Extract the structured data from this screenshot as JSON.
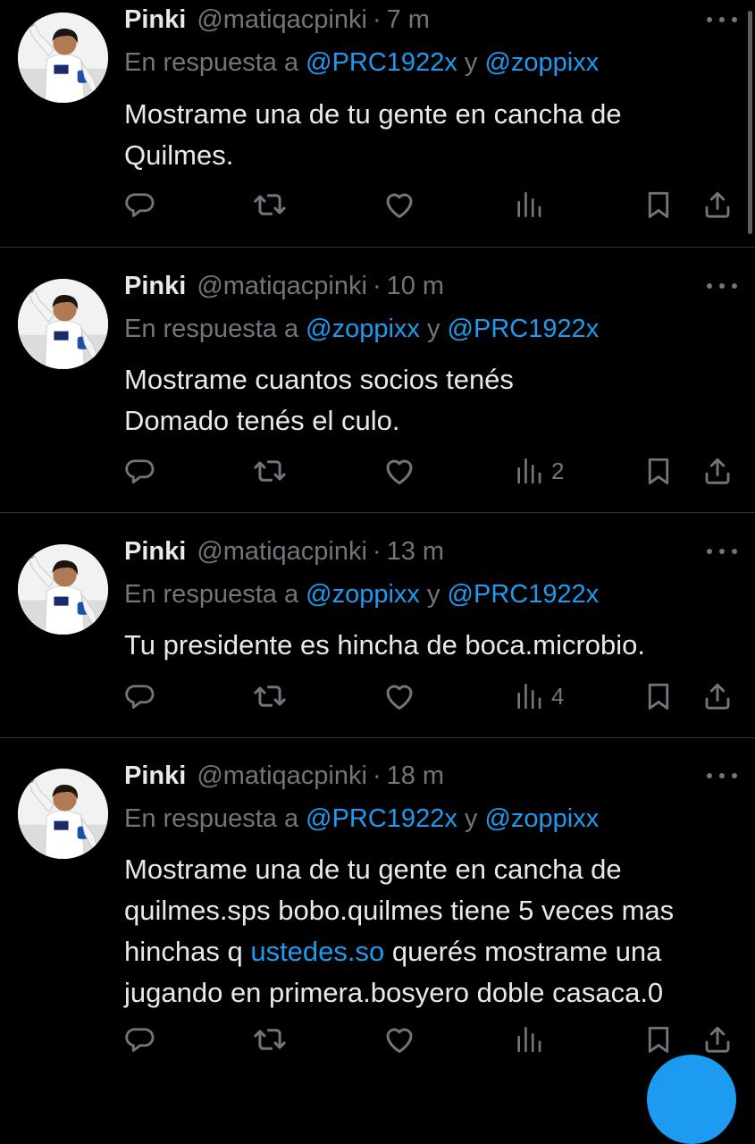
{
  "colors": {
    "background": "#000000",
    "text": "#e7e9ea",
    "muted": "#71767b",
    "accent": "#1d9bf0",
    "divider": "#2f3336"
  },
  "tweets": [
    {
      "name": "Pinki",
      "handle": "@matiqacpinki",
      "sep": "·",
      "time": "7 m",
      "reply_prefix": "En respuesta a ",
      "mention1": "@PRC1922x",
      "reply_and": " y ",
      "mention2": "@zoppixx",
      "text": "Mostrame una de tu gente en cancha de\nQuilmes.",
      "views": ""
    },
    {
      "name": "Pinki",
      "handle": "@matiqacpinki",
      "sep": "·",
      "time": "10 m",
      "reply_prefix": "En respuesta a ",
      "mention1": "@zoppixx",
      "reply_and": " y ",
      "mention2": "@PRC1922x",
      "text": "Mostrame cuantos socios tenés\nDomado tenés el culo.",
      "views": "2"
    },
    {
      "name": "Pinki",
      "handle": "@matiqacpinki",
      "sep": "·",
      "time": "13 m",
      "reply_prefix": "En respuesta a ",
      "mention1": "@zoppixx",
      "reply_and": " y ",
      "mention2": "@PRC1922x",
      "text": "Tu presidente es hincha de boca.microbio.",
      "views": "4"
    },
    {
      "name": "Pinki",
      "handle": "@matiqacpinki",
      "sep": "·",
      "time": "18 m",
      "reply_prefix": "En respuesta a ",
      "mention1": "@PRC1922x",
      "reply_and": " y ",
      "mention2": "@zoppixx",
      "text_before": "Mostrame una de tu gente en cancha de\nquilmes.sps bobo.quilmes tiene 5 veces mas\nhinchas q ",
      "text_link": "ustedes.so",
      "text_after": " querés mostrame una\njugando en primera.bosyero doble casaca.0",
      "views": ""
    }
  ],
  "icons": {
    "more": "more-horizontal-icon",
    "reply": "reply-bubble-icon",
    "retweet": "retweet-icon",
    "like": "heart-icon",
    "views": "views-bar-chart-icon",
    "bookmark": "bookmark-icon",
    "share": "share-upload-icon"
  }
}
